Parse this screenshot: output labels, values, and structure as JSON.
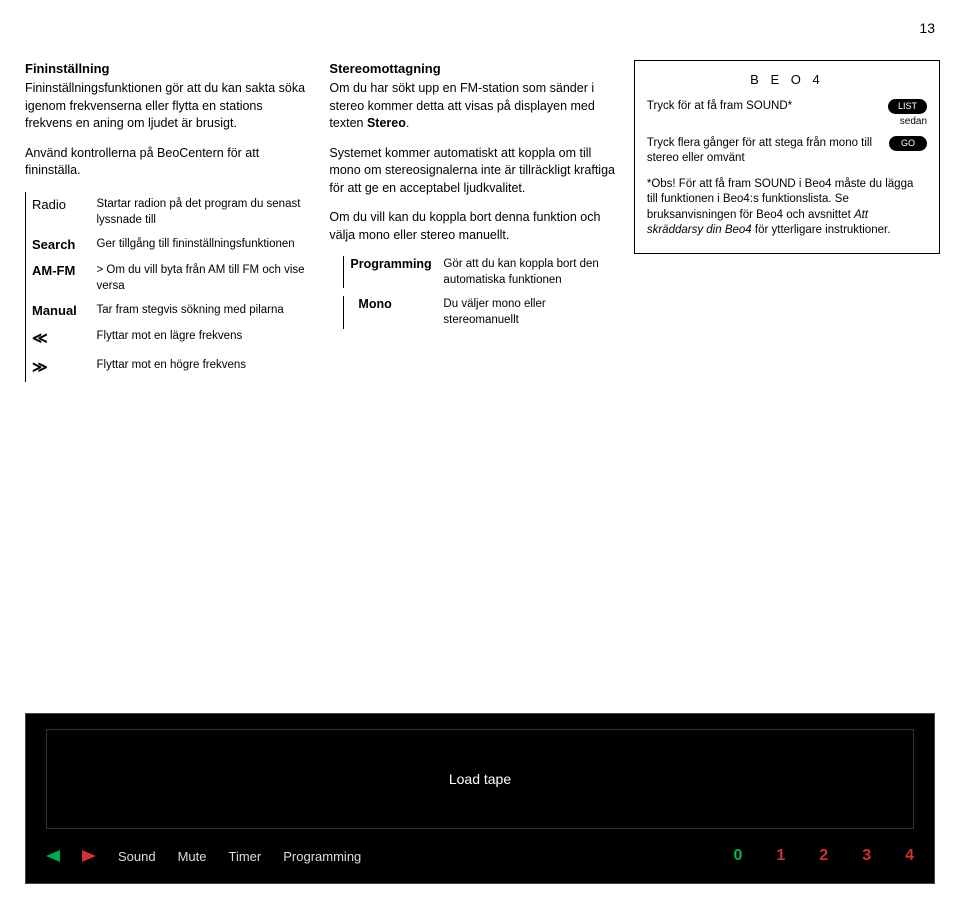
{
  "page_number": "13",
  "col1": {
    "title": "Fininställning",
    "intro": "Fininställningsfunktionen gör att du kan sakta söka igenom frekvenserna eller flytta en stations frekvens en aning om ljudet är brusigt.",
    "intro2": "Använd kontrollerna på BeoCentern för att fininställa.",
    "defs": [
      {
        "term": "Radio",
        "thin": true,
        "desc": "Startar radion på det program du senast lyssnade till"
      },
      {
        "term": "Search",
        "thin": false,
        "desc": "Ger tillgång till fininställningsfunktionen"
      },
      {
        "term": "AM-FM",
        "thin": false,
        "desc": "> Om du vill byta från AM till FM och vise versa"
      },
      {
        "term": "Manual",
        "thin": false,
        "desc": "Tar fram stegvis sökning med pilarna"
      },
      {
        "term": "≪",
        "thin": false,
        "desc": "Flyttar mot en lägre frekvens"
      },
      {
        "term": "≫",
        "thin": false,
        "desc": "Flyttar mot en högre frekvens"
      }
    ]
  },
  "col2": {
    "title": "Stereomottagning",
    "p1a": "Om du har sökt upp en FM-station som sänder i stereo kommer detta att visas på displayen med texten ",
    "p1b": "Stereo",
    "p1c": ".",
    "p2": "Systemet kommer automatiskt att koppla om till mono om stereosignalerna inte är tillräckligt kraftiga för att ge en acceptabel ljudkvalitet.",
    "p3": "Om du vill kan du koppla bort denna funktion och välja mono eller stereo manuellt.",
    "sub": [
      {
        "term": "Programming",
        "desc": "Gör att du kan koppla bort den automatiska funktionen"
      },
      {
        "term": "Mono",
        "desc": "Du väljer mono eller stereomanuellt"
      }
    ]
  },
  "col3": {
    "title": "B E O 4",
    "row1_text": "Tryck för at få fram SOUND*",
    "row1_btn": "LIST",
    "row1_sub": "sedan",
    "row2_text": "Tryck flera gånger för att stega från mono till stereo eller omvänt",
    "row2_btn": "GO",
    "note_a": "*Obs! För att få fram SOUND i Beo4 måste du lägga till funktionen i Beo4:s funktionslista. Se bruksanvisningen för Beo4 och avsnittet ",
    "note_b": "Att skräddarsy din Beo4",
    "note_c": " för ytterligare instruktioner."
  },
  "panel": {
    "load": "Load tape",
    "labels": [
      "Sound",
      "Mute",
      "Timer",
      "Programming"
    ],
    "digits": [
      "0",
      "1",
      "2",
      "3",
      "4"
    ]
  }
}
